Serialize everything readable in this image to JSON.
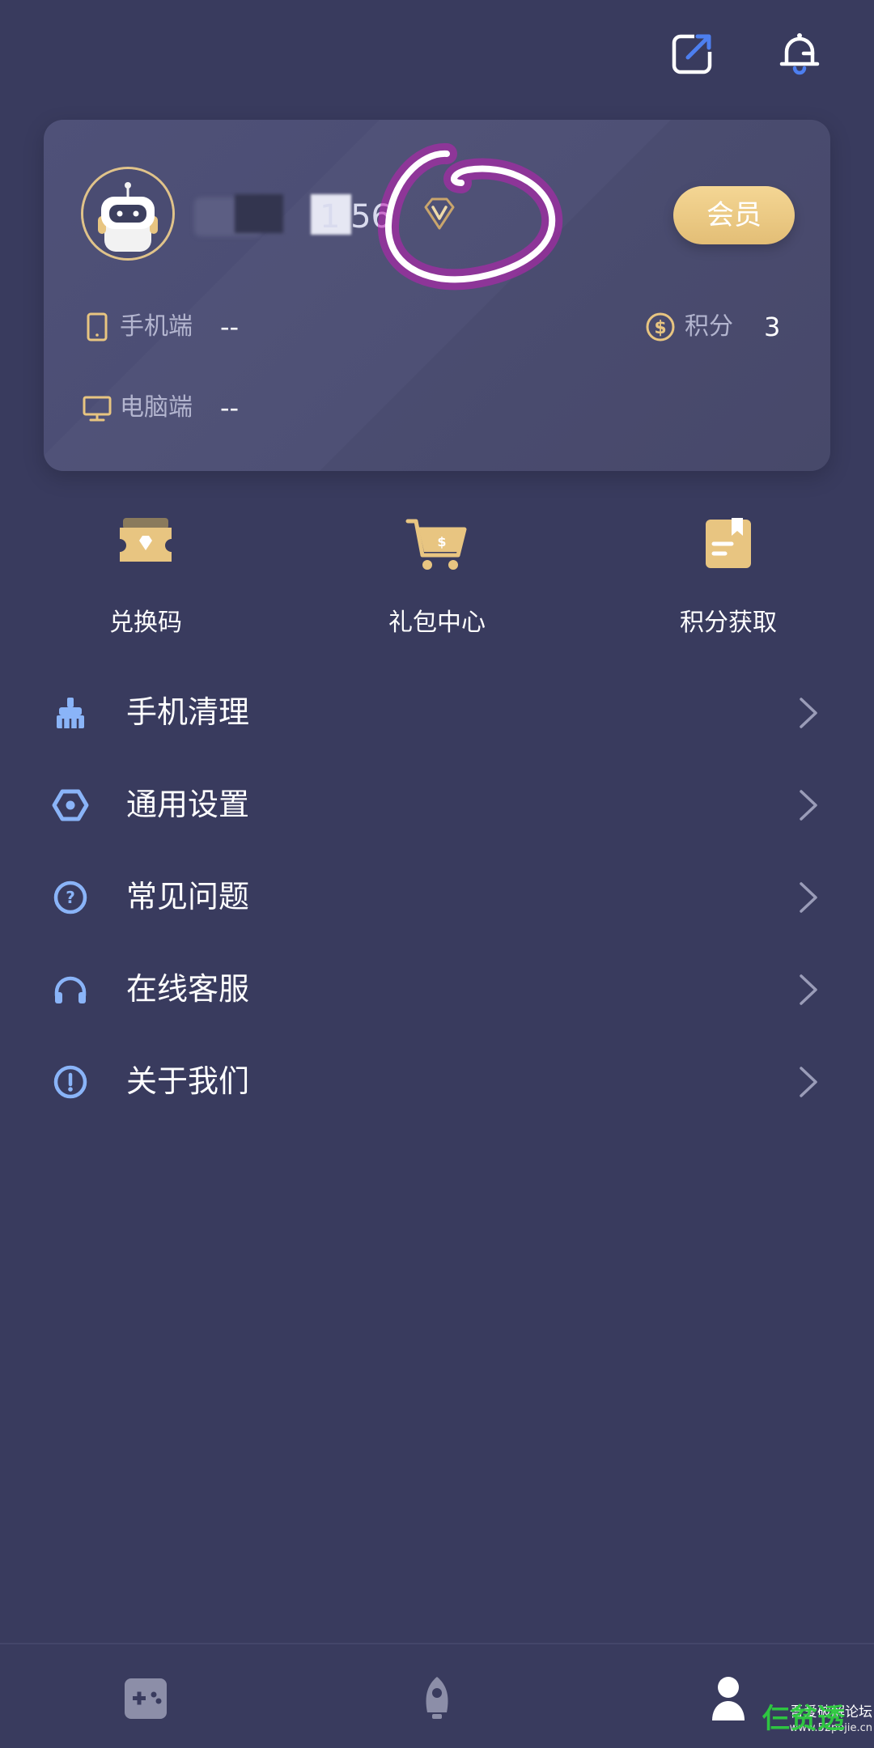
{
  "colors": {
    "background": "#393b5e",
    "card": "#4b4d73",
    "gold": "#e8c581",
    "menu_icon_blue": "#8ab4f8",
    "scribble": "#c11fb5"
  },
  "header": {
    "share_icon": "share-external-icon",
    "bell_icon": "notification-bell-icon"
  },
  "profile": {
    "username": "1 56",
    "member_label": "会员",
    "vip_icon": "vip-diamond-icon",
    "mobile_label": "手机端",
    "mobile_value": "--",
    "pc_label": "电脑端",
    "pc_value": "--",
    "points_label": "积分",
    "points_value": "3"
  },
  "quick_actions": [
    {
      "label": "兑换码",
      "icon": "redeem-ticket-icon"
    },
    {
      "label": "礼包中心",
      "icon": "gift-cart-icon"
    },
    {
      "label": "积分获取",
      "icon": "points-note-icon"
    }
  ],
  "menu": [
    {
      "label": "手机清理",
      "icon": "broom-clean-icon"
    },
    {
      "label": "通用设置",
      "icon": "settings-hex-icon"
    },
    {
      "label": "常见问题",
      "icon": "question-circle-icon"
    },
    {
      "label": "在线客服",
      "icon": "headset-icon"
    },
    {
      "label": "关于我们",
      "icon": "info-circle-icon"
    }
  ],
  "bottom_nav": [
    {
      "name": "games",
      "icon": "gamepad-icon"
    },
    {
      "name": "boost",
      "icon": "rocket-icon"
    },
    {
      "name": "profile",
      "icon": "user-icon"
    }
  ],
  "watermark": {
    "line1": "吾爱破解论坛",
    "line2": "www.52pojie.cn",
    "line3": "仨贫透"
  }
}
